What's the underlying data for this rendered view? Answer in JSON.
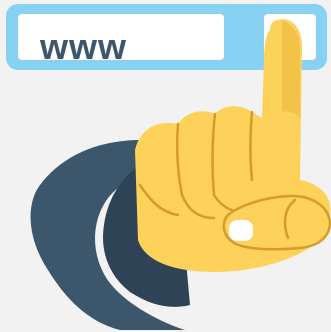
{
  "address_bar": {
    "url_text": "www"
  },
  "colors": {
    "background": "#f2f2f2",
    "bar": "#87d1f2",
    "field": "#ffffff",
    "text": "#3c566b",
    "hand": "#fcd25a",
    "hand_shadow": "#eab43c",
    "cuff": "#3c566b",
    "cuff_dark": "#2e4355",
    "nail": "#ffffff"
  },
  "icons": {
    "hand": "pointing-hand-icon"
  }
}
